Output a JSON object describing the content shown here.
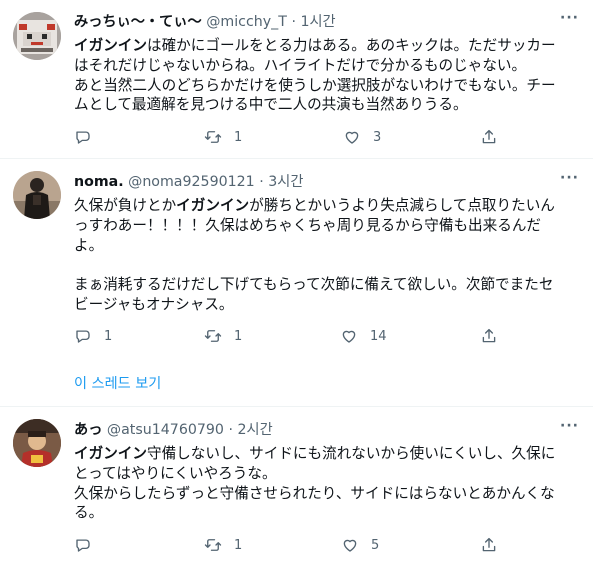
{
  "tweets": [
    {
      "name": "みっちぃ～・てぃ～",
      "handle": "@micchy_T",
      "dot": "·",
      "time": "1시간",
      "lines": [
        {
          "pre": "",
          "hl": "イガンイン",
          "post": "は確かにゴールをとる力はある。あのキックは。ただサッカー"
        },
        {
          "pre": "はそれだけじゃないからね。ハイライトだけで分かるものじゃない。",
          "hl": "",
          "post": ""
        },
        {
          "pre": "あと当然二人のどちらかだけを使うしか選択肢がないわけでもない。チー",
          "hl": "",
          "post": ""
        },
        {
          "pre": "ムとして最適解を見つける中で二人の共演も当然ありうる。",
          "hl": "",
          "post": ""
        }
      ],
      "reply_count": "",
      "retweet_count": "1",
      "like_count": "3"
    },
    {
      "name": "noma.",
      "handle": "@noma92590121",
      "dot": "·",
      "time": "3시간",
      "lines": [
        {
          "pre": "久保が負けとか",
          "hl": "イガンイン",
          "post": "が勝ちとかいうより失点減らして点取りたいん"
        },
        {
          "pre": "っすわあー！！！！久保はめちゃくちゃ周り見るから守備も出来るんだ",
          "hl": "",
          "post": ""
        },
        {
          "pre": "よ。",
          "hl": "",
          "post": ""
        },
        {
          "pre": "",
          "hl": "",
          "post": ""
        },
        {
          "pre": "まぁ消耗するだけだし下げてもらって次節に備えて欲しい。次節でまたセ",
          "hl": "",
          "post": ""
        },
        {
          "pre": "ビージャもオナシャス。",
          "hl": "",
          "post": ""
        }
      ],
      "reply_count": "1",
      "retweet_count": "1",
      "like_count": "14",
      "thread_link": "이 스레드 보기"
    },
    {
      "name": "あっ",
      "handle": "@atsu14760790",
      "dot": "·",
      "time": "2시간",
      "lines": [
        {
          "pre": "",
          "hl": "イガンイン",
          "post": "守備しないし、サイドにも流れないから使いにくいし、久保に"
        },
        {
          "pre": "とってはやりにくいやろうな。",
          "hl": "",
          "post": ""
        },
        {
          "pre": "久保からしたらずっと守備させられたり、サイドにはらないとあかんくな",
          "hl": "",
          "post": ""
        },
        {
          "pre": "る。",
          "hl": "",
          "post": ""
        }
      ],
      "reply_count": "",
      "retweet_count": "1",
      "like_count": "5"
    }
  ],
  "more_label": "···",
  "colors": {
    "text": "#0f1419",
    "muted": "#536471",
    "link": "#1d9bf0",
    "divider": "#eff3f4"
  },
  "icons": [
    "reply-icon",
    "retweet-icon",
    "like-icon",
    "share-icon",
    "more-icon"
  ]
}
